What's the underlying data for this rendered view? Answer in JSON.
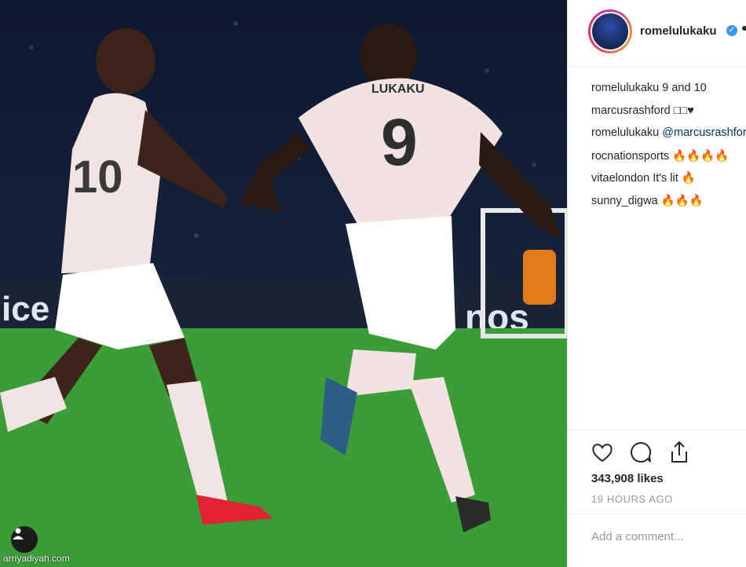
{
  "post": {
    "username": "romelulukaku",
    "verified_icon": "verified-check-icon",
    "watermark": "arriyadiyah.com",
    "comments": [
      {
        "user": "romelulukaku",
        "text": " 9 and 10",
        "mention": ""
      },
      {
        "user": "marcusrashford",
        "text": " □□♥",
        "mention": ""
      },
      {
        "user": "romelulukaku",
        "text": " ",
        "mention": "@marcusrashford"
      },
      {
        "user": "rocnationsports",
        "text": " 🔥🔥🔥🔥",
        "mention": ""
      },
      {
        "user": "vitaelondon",
        "text": " It's lit 🔥",
        "mention": ""
      },
      {
        "user": "sunny_digwa",
        "text": " 🔥🔥🔥",
        "mention": ""
      }
    ],
    "likes": "343,908 likes",
    "time": "19 HOURS AGO",
    "add_comment_placeholder": "Add a comment...",
    "actions": [
      "heart-icon",
      "comment-icon",
      "share-icon"
    ]
  },
  "photo": {
    "jersey_left_number": "10",
    "jersey_right_number": "9",
    "jersey_right_name": "LUKAKU",
    "board_left_text": "ice",
    "board_right_text": "nos"
  },
  "colors": {
    "accent_blue": "#3897f0",
    "mention_blue": "#003569",
    "muted_gray": "#999999",
    "pitch_green": "#3ea43a"
  }
}
